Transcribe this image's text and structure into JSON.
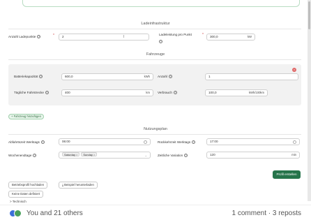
{
  "sections": {
    "ladeinfrastruktur": "Ladeinfrastruktur",
    "fahrzeuge": "Fahrzeuge",
    "nutzungsplan": "Nutzungsplan"
  },
  "ladeinfrastruktur": {
    "anzahl_label": "Anzahl Ladepunkte",
    "anzahl_value": "2",
    "leistung_label_line1": "Ladeleistung pro Punkt",
    "leistung_value": "300,0",
    "leistung_unit": "kW"
  },
  "fahrzeug": {
    "batterie_label": "Batteriekapazität",
    "batterie_value": "600,0",
    "batterie_unit": "kWh",
    "anzahl_label": "Anzahl",
    "anzahl_value": "1",
    "fahrstrecke_label": "Tägliche Fahrstrecke",
    "fahrstrecke_value": "400",
    "fahrstrecke_unit": "km",
    "verbrauch_label": "Verbrauch",
    "verbrauch_value": "100,0",
    "verbrauch_unit": "kWh/100km",
    "remove_icon": "×",
    "add_label": "+ Fahrzeug hinzufügen"
  },
  "nutzungsplan": {
    "abfahrt_label": "Abfahrtszeit Werktags",
    "abfahrt_value": "06:00",
    "rueckkehr_label": "Rückkehrzeit Werktags",
    "rueckkehr_value": "17:00",
    "wochenende_label": "Wochenendtage",
    "wochenende_chips": [
      "Saturday",
      "Sunday"
    ],
    "variation_label": "Zeitliche Variation",
    "variation_value": "120",
    "variation_unit": "min"
  },
  "actions": {
    "profil_erstellen": "Profil erstellen",
    "betriebsprofil_hochladen": "Betriebsprofil hochladen",
    "beispiel_herunterladen": "Beispiel herunterladen",
    "keine_daten": "Keine Daten definiert",
    "technisch": "> Technisch"
  },
  "social": {
    "reactions": "You and 21 others",
    "stats": "1 comment · 3 reposts"
  },
  "colors": {
    "primary": "#26744b",
    "accent_light": "#e9f6ec",
    "danger": "#e06a6a"
  }
}
